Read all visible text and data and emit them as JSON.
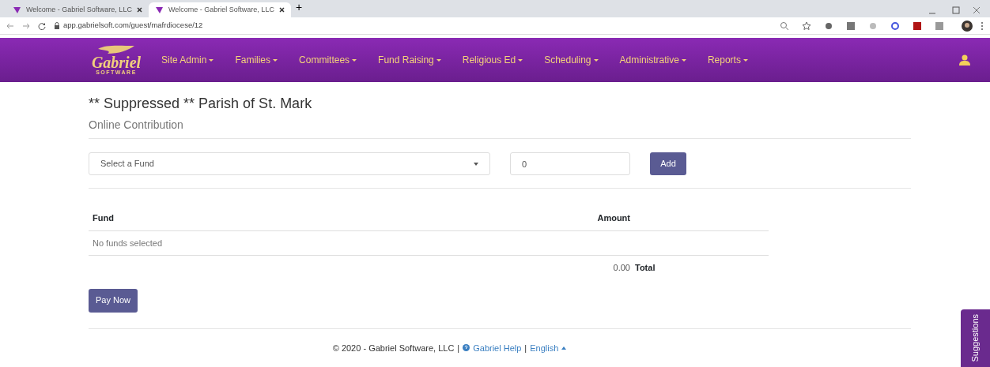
{
  "browser": {
    "tabs": [
      {
        "title": "Welcome - Gabriel Software, LLC",
        "selected": false
      },
      {
        "title": "Welcome - Gabriel Software, LLC",
        "selected": true
      }
    ],
    "new_tab": "+",
    "address": "app.gabrielsoft.com/guest/mafrdiocese/12"
  },
  "navbar": {
    "logo": {
      "name": "Gabriel",
      "tagline": "SOFTWARE"
    },
    "menus": [
      {
        "label": "Site Admin"
      },
      {
        "label": "Families"
      },
      {
        "label": "Committees"
      },
      {
        "label": "Fund Raising"
      },
      {
        "label": "Religious Ed"
      },
      {
        "label": "Scheduling"
      },
      {
        "label": "Administrative"
      },
      {
        "label": "Reports"
      }
    ]
  },
  "page": {
    "title": "** Suppressed ** Parish of St. Mark",
    "subtitle": "Online Contribution"
  },
  "form": {
    "fund_select": {
      "value": "Select a Fund"
    },
    "amount": {
      "value": "0"
    },
    "add_button": "Add"
  },
  "table": {
    "columns": [
      "Fund",
      "Amount"
    ],
    "empty_message": "No funds selected",
    "total": {
      "value": "0.00",
      "label": "Total"
    }
  },
  "pay_button": "Pay Now",
  "footer": {
    "copyright": "© 2020 - Gabriel Software, LLC",
    "separator_1": "|",
    "help_link": "Gabriel Help",
    "separator_2": "|",
    "language": "English"
  },
  "suggestions_tab": "Suggestions"
}
